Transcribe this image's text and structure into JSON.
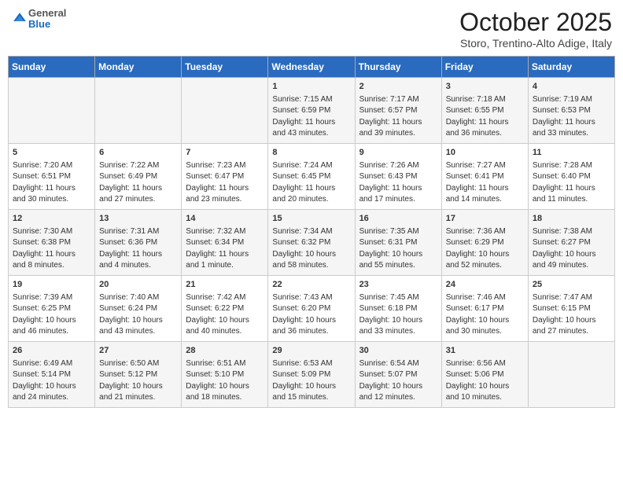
{
  "header": {
    "logo_general": "General",
    "logo_blue": "Blue",
    "title": "October 2025",
    "subtitle": "Storo, Trentino-Alto Adige, Italy"
  },
  "weekdays": [
    "Sunday",
    "Monday",
    "Tuesday",
    "Wednesday",
    "Thursday",
    "Friday",
    "Saturday"
  ],
  "weeks": [
    [
      {
        "day": "",
        "info": ""
      },
      {
        "day": "",
        "info": ""
      },
      {
        "day": "",
        "info": ""
      },
      {
        "day": "1",
        "info": "Sunrise: 7:15 AM\nSunset: 6:59 PM\nDaylight: 11 hours and 43 minutes."
      },
      {
        "day": "2",
        "info": "Sunrise: 7:17 AM\nSunset: 6:57 PM\nDaylight: 11 hours and 39 minutes."
      },
      {
        "day": "3",
        "info": "Sunrise: 7:18 AM\nSunset: 6:55 PM\nDaylight: 11 hours and 36 minutes."
      },
      {
        "day": "4",
        "info": "Sunrise: 7:19 AM\nSunset: 6:53 PM\nDaylight: 11 hours and 33 minutes."
      }
    ],
    [
      {
        "day": "5",
        "info": "Sunrise: 7:20 AM\nSunset: 6:51 PM\nDaylight: 11 hours and 30 minutes."
      },
      {
        "day": "6",
        "info": "Sunrise: 7:22 AM\nSunset: 6:49 PM\nDaylight: 11 hours and 27 minutes."
      },
      {
        "day": "7",
        "info": "Sunrise: 7:23 AM\nSunset: 6:47 PM\nDaylight: 11 hours and 23 minutes."
      },
      {
        "day": "8",
        "info": "Sunrise: 7:24 AM\nSunset: 6:45 PM\nDaylight: 11 hours and 20 minutes."
      },
      {
        "day": "9",
        "info": "Sunrise: 7:26 AM\nSunset: 6:43 PM\nDaylight: 11 hours and 17 minutes."
      },
      {
        "day": "10",
        "info": "Sunrise: 7:27 AM\nSunset: 6:41 PM\nDaylight: 11 hours and 14 minutes."
      },
      {
        "day": "11",
        "info": "Sunrise: 7:28 AM\nSunset: 6:40 PM\nDaylight: 11 hours and 11 minutes."
      }
    ],
    [
      {
        "day": "12",
        "info": "Sunrise: 7:30 AM\nSunset: 6:38 PM\nDaylight: 11 hours and 8 minutes."
      },
      {
        "day": "13",
        "info": "Sunrise: 7:31 AM\nSunset: 6:36 PM\nDaylight: 11 hours and 4 minutes."
      },
      {
        "day": "14",
        "info": "Sunrise: 7:32 AM\nSunset: 6:34 PM\nDaylight: 11 hours and 1 minute."
      },
      {
        "day": "15",
        "info": "Sunrise: 7:34 AM\nSunset: 6:32 PM\nDaylight: 10 hours and 58 minutes."
      },
      {
        "day": "16",
        "info": "Sunrise: 7:35 AM\nSunset: 6:31 PM\nDaylight: 10 hours and 55 minutes."
      },
      {
        "day": "17",
        "info": "Sunrise: 7:36 AM\nSunset: 6:29 PM\nDaylight: 10 hours and 52 minutes."
      },
      {
        "day": "18",
        "info": "Sunrise: 7:38 AM\nSunset: 6:27 PM\nDaylight: 10 hours and 49 minutes."
      }
    ],
    [
      {
        "day": "19",
        "info": "Sunrise: 7:39 AM\nSunset: 6:25 PM\nDaylight: 10 hours and 46 minutes."
      },
      {
        "day": "20",
        "info": "Sunrise: 7:40 AM\nSunset: 6:24 PM\nDaylight: 10 hours and 43 minutes."
      },
      {
        "day": "21",
        "info": "Sunrise: 7:42 AM\nSunset: 6:22 PM\nDaylight: 10 hours and 40 minutes."
      },
      {
        "day": "22",
        "info": "Sunrise: 7:43 AM\nSunset: 6:20 PM\nDaylight: 10 hours and 36 minutes."
      },
      {
        "day": "23",
        "info": "Sunrise: 7:45 AM\nSunset: 6:18 PM\nDaylight: 10 hours and 33 minutes."
      },
      {
        "day": "24",
        "info": "Sunrise: 7:46 AM\nSunset: 6:17 PM\nDaylight: 10 hours and 30 minutes."
      },
      {
        "day": "25",
        "info": "Sunrise: 7:47 AM\nSunset: 6:15 PM\nDaylight: 10 hours and 27 minutes."
      }
    ],
    [
      {
        "day": "26",
        "info": "Sunrise: 6:49 AM\nSunset: 5:14 PM\nDaylight: 10 hours and 24 minutes."
      },
      {
        "day": "27",
        "info": "Sunrise: 6:50 AM\nSunset: 5:12 PM\nDaylight: 10 hours and 21 minutes."
      },
      {
        "day": "28",
        "info": "Sunrise: 6:51 AM\nSunset: 5:10 PM\nDaylight: 10 hours and 18 minutes."
      },
      {
        "day": "29",
        "info": "Sunrise: 6:53 AM\nSunset: 5:09 PM\nDaylight: 10 hours and 15 minutes."
      },
      {
        "day": "30",
        "info": "Sunrise: 6:54 AM\nSunset: 5:07 PM\nDaylight: 10 hours and 12 minutes."
      },
      {
        "day": "31",
        "info": "Sunrise: 6:56 AM\nSunset: 5:06 PM\nDaylight: 10 hours and 10 minutes."
      },
      {
        "day": "",
        "info": ""
      }
    ]
  ]
}
